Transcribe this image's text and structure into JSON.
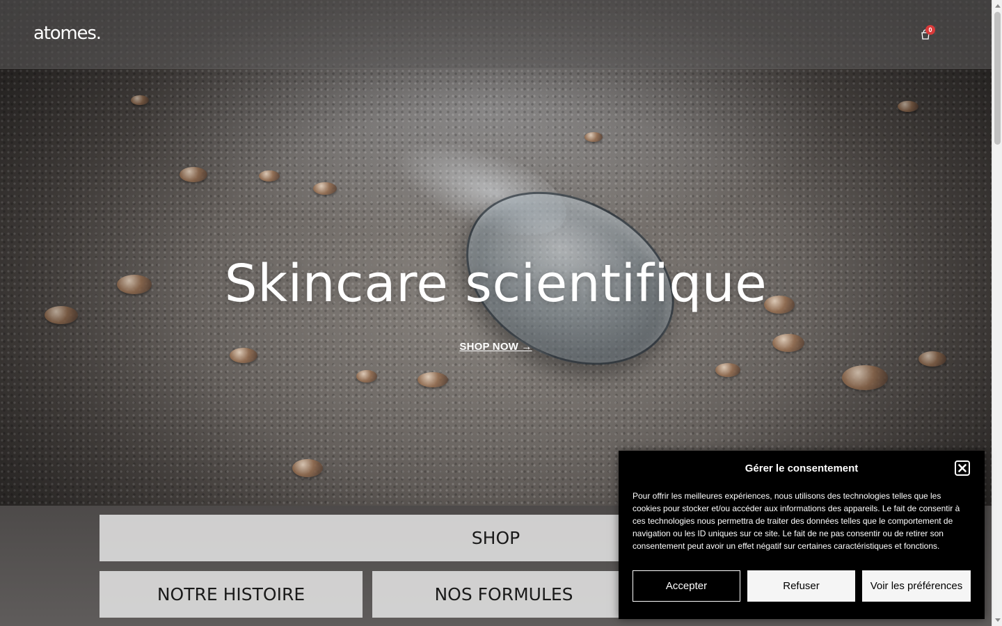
{
  "header": {
    "logo": "atomes.",
    "cart_count": "0"
  },
  "hero": {
    "title": "Skincare scientifique",
    "cta": "SHOP NOW →"
  },
  "tiles": {
    "shop": "SHOP",
    "histoire": "NOTRE HISTOIRE",
    "formules": "NOS FORMULES"
  },
  "consent": {
    "title": "Gérer le consentement",
    "text": "Pour offrir les meilleures expériences, nous utilisons des technologies telles que les cookies pour stocker et/ou accéder aux informations des appareils. Le fait de consentir à ces technologies nous permettra de traiter des données telles que le comportement de navigation ou les ID uniques sur ce site. Le fait de ne pas consentir ou de retirer son consentement peut avoir un effet négatif sur certaines caractéristiques et fonctions.",
    "accept": "Accepter",
    "refuse": "Refuser",
    "preferences": "Voir les préférences"
  },
  "colors": {
    "badge": "#d93a3a",
    "modal_bg": "#000000",
    "tile_bg": "#e1e1e1"
  },
  "icons": {
    "cart": "shopping-bag-icon",
    "close": "close-icon"
  }
}
